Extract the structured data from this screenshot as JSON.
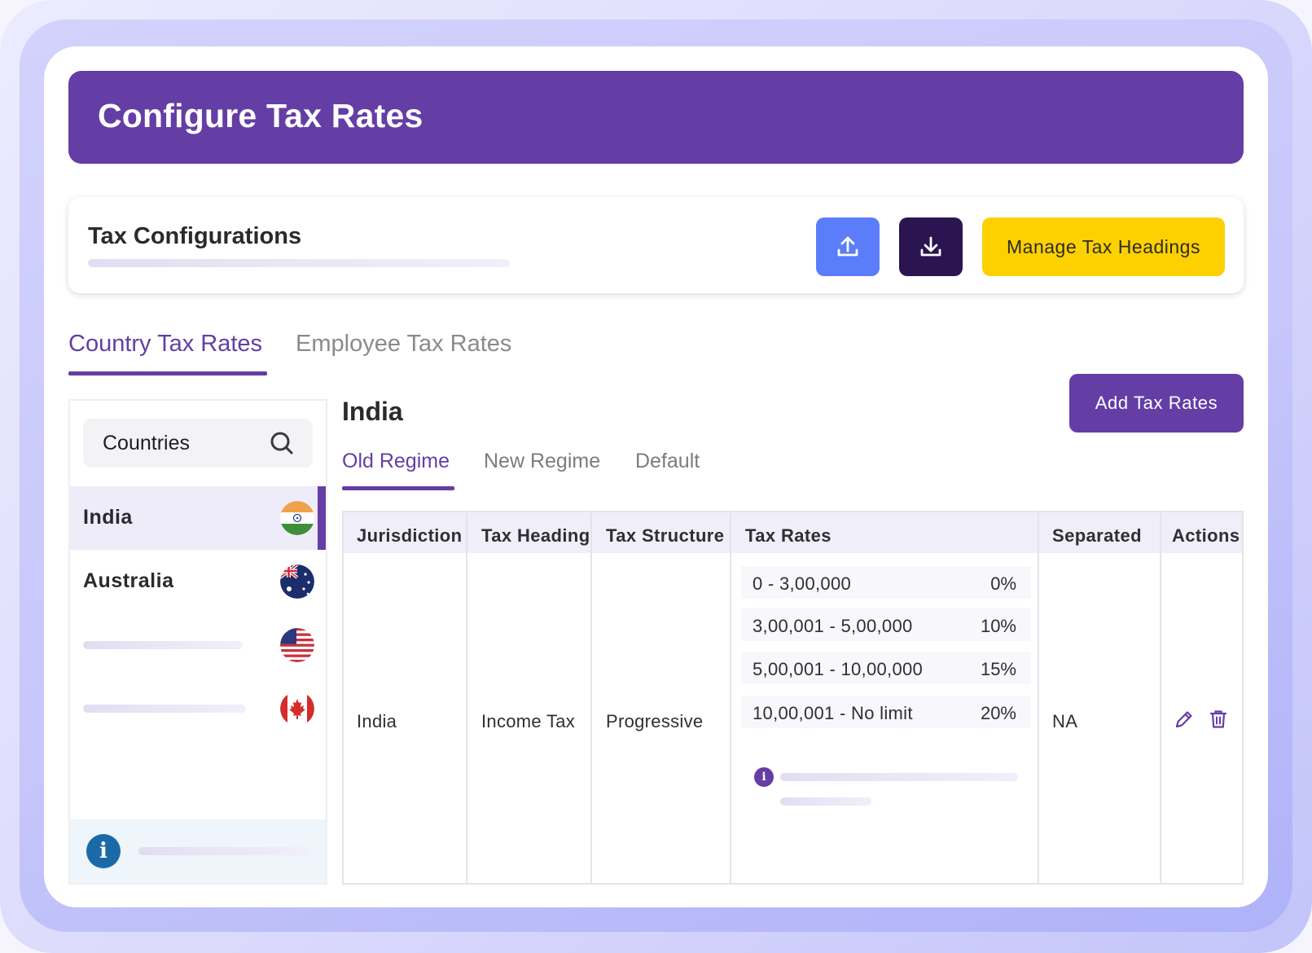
{
  "header": {
    "title": "Configure Tax Rates"
  },
  "config": {
    "title": "Tax Configurations",
    "upload_icon": "upload-icon",
    "download_icon": "download-icon",
    "manage_label": "Manage Tax Headings"
  },
  "tabs": [
    {
      "label": "Country Tax Rates",
      "active": true
    },
    {
      "label": "Employee Tax Rates",
      "active": false
    }
  ],
  "sidebar": {
    "search_placeholder": "Countries",
    "countries": [
      {
        "name": "India",
        "flag": "india-flag",
        "active": true
      },
      {
        "name": "Australia",
        "flag": "australia-flag",
        "active": false
      },
      {
        "name": "",
        "flag": "usa-flag",
        "active": false
      },
      {
        "name": "",
        "flag": "canada-flag",
        "active": false
      }
    ]
  },
  "main": {
    "country": "India",
    "add_label": "Add Tax Rates",
    "subtabs": [
      {
        "label": "Old Regime",
        "active": true
      },
      {
        "label": "New Regime",
        "active": false
      },
      {
        "label": "Default",
        "active": false
      }
    ],
    "columns": [
      "Jurisdiction",
      "Tax Heading",
      "Tax Structure",
      "Tax Rates",
      "Separated",
      "Actions"
    ],
    "row": {
      "jurisdiction": "India",
      "tax_heading": "Income Tax",
      "tax_structure": "Progressive",
      "rates": [
        {
          "range": "0 - 3,00,000",
          "pct": "0%"
        },
        {
          "range": "3,00,001 - 5,00,000",
          "pct": "10%"
        },
        {
          "range": "5,00,001 - 10,00,000",
          "pct": "15%"
        },
        {
          "range": "10,00,001 - No limit",
          "pct": "20%"
        }
      ],
      "separated": "NA"
    }
  },
  "colors": {
    "primary": "#643ea5",
    "accent_yellow": "#fdd100",
    "upload_blue": "#5b7dfb",
    "dark_purple": "#2b1550"
  }
}
